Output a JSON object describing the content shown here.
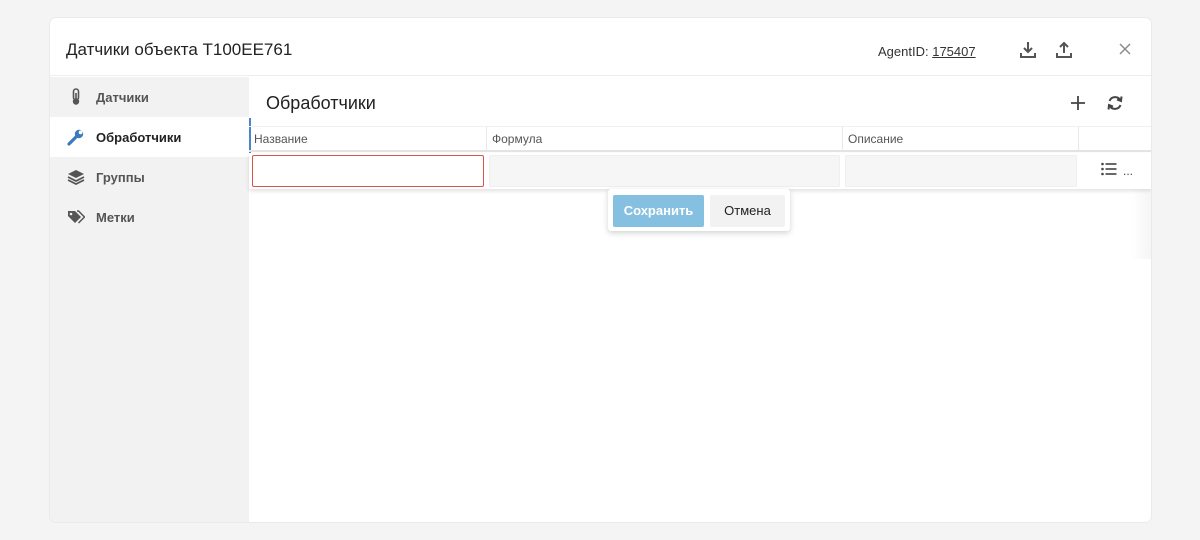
{
  "window": {
    "title": "Датчики объекта Т100ЕЕ761",
    "agent_label": "AgentID:",
    "agent_id": "175407"
  },
  "sidebar": {
    "items": [
      {
        "label": "Датчики",
        "icon": "thermometer-icon",
        "active": false
      },
      {
        "label": "Обработчики",
        "icon": "wrench-icon",
        "active": true
      },
      {
        "label": "Группы",
        "icon": "layers-icon",
        "active": false
      },
      {
        "label": "Метки",
        "icon": "tags-icon",
        "active": false
      }
    ]
  },
  "main": {
    "title": "Обработчики",
    "columns": [
      "Название",
      "Формула",
      "Описание"
    ],
    "row_menu_label": "...",
    "popup": {
      "save_label": "Сохранить",
      "cancel_label": "Отмена"
    }
  },
  "colors": {
    "accent": "#4a86c8",
    "save_button": "#86c0e0",
    "error_border": "#d9534f"
  }
}
